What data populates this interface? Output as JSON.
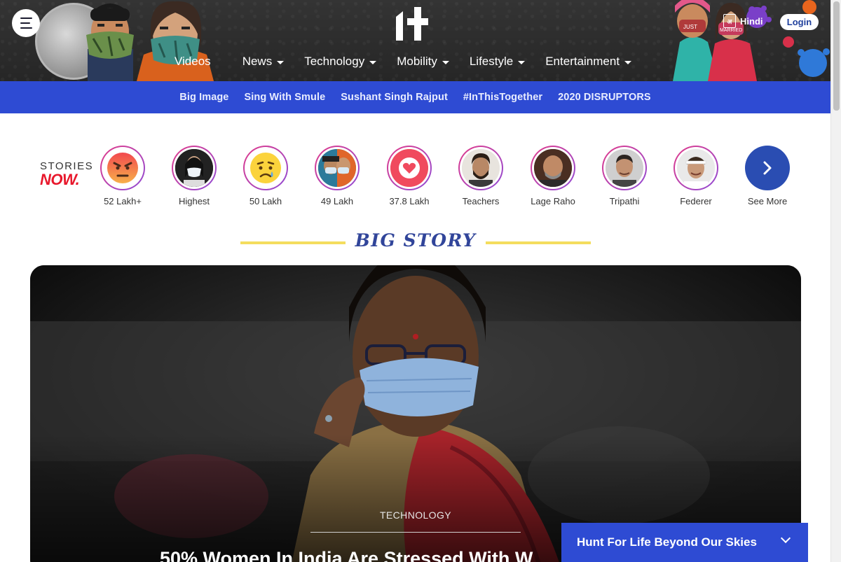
{
  "header": {
    "menu_icon": "hamburger-icon",
    "logo_icon": "brand-logo-icon",
    "nav": [
      {
        "label": "Videos",
        "has_dropdown": false
      },
      {
        "label": "News",
        "has_dropdown": true
      },
      {
        "label": "Technology",
        "has_dropdown": true
      },
      {
        "label": "Mobility",
        "has_dropdown": true
      },
      {
        "label": "Lifestyle",
        "has_dropdown": true
      },
      {
        "label": "Entertainment",
        "has_dropdown": true
      }
    ],
    "language_label": "Hindi",
    "language_icon": "language-icon",
    "login_label": "Login"
  },
  "subnav": {
    "links": [
      "Big Image",
      "Sing With Smule",
      "Sushant Singh Rajput",
      "#InThisTogether",
      "2020 DISRUPTORS"
    ]
  },
  "stories": {
    "label_top": "STORIES",
    "label_bottom": "NOW.",
    "items": [
      {
        "label": "52 Lakh+",
        "icon": "angry-emoji-icon"
      },
      {
        "label": "Highest",
        "icon": "masked-woman-avatar"
      },
      {
        "label": "50 Lakh",
        "icon": "sad-emoji-icon"
      },
      {
        "label": "49 Lakh",
        "icon": "masked-people-avatar"
      },
      {
        "label": "37.8 Lakh",
        "icon": "heart-icon"
      },
      {
        "label": "Teachers",
        "icon": "man-beard-avatar"
      },
      {
        "label": "Lage Raho",
        "icon": "bald-man-avatar"
      },
      {
        "label": "Tripathi",
        "icon": "man-avatar"
      },
      {
        "label": "Federer",
        "icon": "tennis-player-avatar"
      },
      {
        "label": "See More",
        "icon": "chevron-right-icon"
      }
    ]
  },
  "big_story": {
    "heading": "BIG STORY",
    "category": "TECHNOLOGY",
    "title": "50% Women In India Are Stressed With W"
  },
  "notification": {
    "text": "Hunt For Life Beyond Our Skies",
    "icon": "chevron-down-icon"
  },
  "colors": {
    "primary_blue": "#2e4bd3",
    "header_dark": "#2c2c2c",
    "stories_red": "#e8182c",
    "heading_blue": "#31459a",
    "accent_yellow": "#f4dd5e"
  }
}
